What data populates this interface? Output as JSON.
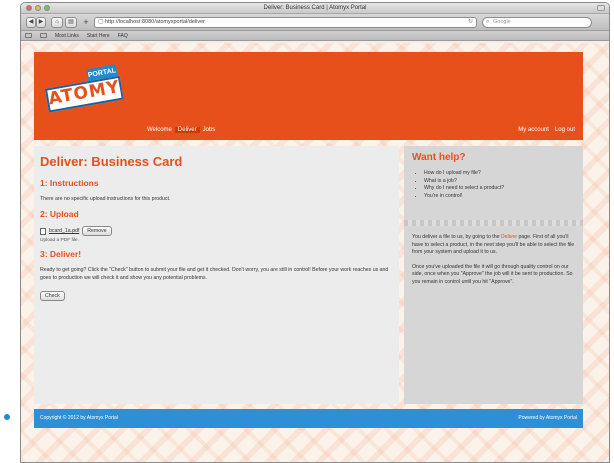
{
  "window": {
    "title": "Deliver: Business Card | Atomyx Portal"
  },
  "toolbar": {
    "back": "◀",
    "forward": "▶",
    "add": "+",
    "url": "http://localhost:8080/atomyxportal/deliver",
    "search_placeholder": "Google"
  },
  "bookmarks": [
    "Most Links",
    "Start Here",
    "FAQ"
  ],
  "header": {
    "logo_main": "ATOMYX",
    "logo_tag": "PORTAL",
    "nav": [
      "Welcome",
      "Deliver",
      "Jobs"
    ],
    "account": [
      "My account",
      "Log out"
    ]
  },
  "content": {
    "title": "Deliver: Business Card",
    "s1_title": "1: Instructions",
    "s1_text": "There are no specific upload instructions for this product.",
    "s2_title": "2: Upload",
    "file_name": "bcard_1a.pdf",
    "remove": "Remove",
    "upload_note": "Upload a PDF file.",
    "s3_title": "3: Deliver!",
    "s3_text": "Ready to get going? Click the \"Check\" button to submit your file and get it checked. Don't worry, you are still in control! Before your work reaches us and goes to production we will check it and show you any potential problems.",
    "check": "Check"
  },
  "help": {
    "title": "Want help?",
    "questions": [
      "How do I upload my file?",
      "What is a job?",
      "Why do I need to select a product?",
      "You're in control!"
    ],
    "p1_pre": "You deliver a file to us, by going to the ",
    "p1_link": "Deliver",
    "p1_post": " page. First of all you'll have to select a product, in the next step you'll be able to select the file from your system and upload it to us.",
    "p2": "Once you've uploaded the file it will go through quality control on our side, once when you \"Approve\" the job will it be sent to production. So you remain in control until you hit \"Approve\"."
  },
  "footer": {
    "copyright": "Copyright © 2012 by Atomyx Portal",
    "powered": "Powered by Atomyx Portal"
  },
  "colors": {
    "brand_orange": "#e8501b",
    "footer_blue": "#2d8fd5",
    "logo_blue": "#1f5f9b"
  }
}
